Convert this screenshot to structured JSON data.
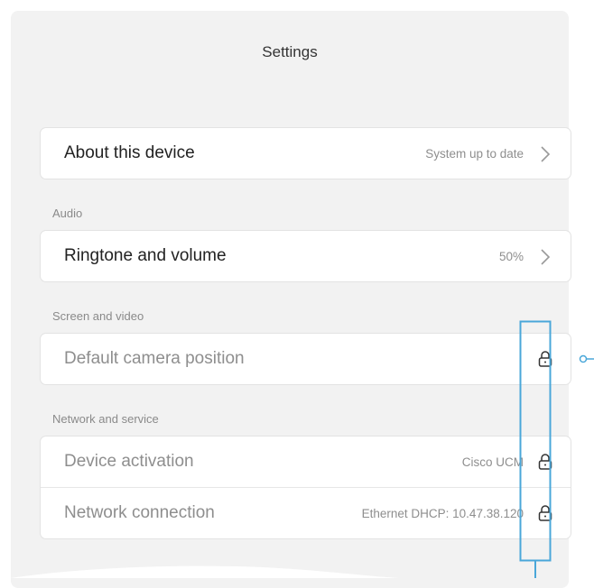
{
  "header": {
    "title": "Settings"
  },
  "sections": [
    {
      "label": "",
      "items": [
        {
          "label": "About this device",
          "value": "System up to date",
          "icon": "chevron-right-icon",
          "muted": false
        }
      ]
    },
    {
      "label": "Audio",
      "items": [
        {
          "label": "Ringtone and volume",
          "value": "50%",
          "icon": "chevron-right-icon",
          "muted": false
        }
      ]
    },
    {
      "label": "Screen and video",
      "items": [
        {
          "label": "Default camera position",
          "value": "",
          "icon": "lock-icon",
          "muted": true
        }
      ]
    },
    {
      "label": "Network and service",
      "items": [
        {
          "label": "Device activation",
          "value": "Cisco UCM",
          "icon": "lock-icon",
          "muted": true
        },
        {
          "label": "Network connection",
          "value": "Ethernet DHCP: 10.47.38.120",
          "icon": "lock-icon",
          "muted": true
        }
      ]
    }
  ],
  "colors": {
    "annotation": "#4aa7d9",
    "panel": "#f2f2f2",
    "text": "#222222",
    "muted": "#8e8e8e"
  }
}
